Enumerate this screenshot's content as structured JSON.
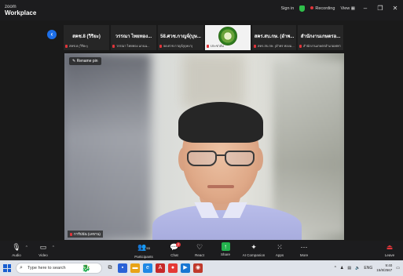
{
  "app": {
    "logo_top": "zoom",
    "logo_bottom": "Workplace"
  },
  "titlebar": {
    "signin": "Sign in",
    "recording": "Recording",
    "view": "View",
    "minimize": "–",
    "restore": "❐",
    "close": "✕"
  },
  "gallery": {
    "back": "‹",
    "tiles": [
      {
        "name": "สคช.8 (วิริยะ)",
        "sub": "สคช.8 (วิริยะ)"
      },
      {
        "name": "วรรณา ไทยทอง...",
        "sub": "วรรณา ไทยทอง แกนน..."
      },
      {
        "name": "58.ศวช.กาญจ์(บุษ...",
        "sub": "58.ศวช.กาญจ์(บุษบา)"
      },
      {
        "name": "",
        "sub": "ประชาสัม"
      },
      {
        "name": "สคร.สบ.กษ. (อำพ...",
        "sub": "สคร.สบ.กษ. (อำพร ทองม..."
      },
      {
        "name": "สำนักงานเกษตรอ...",
        "sub": "สำนักงานเกษตรอำเภอเทพา"
      }
    ]
  },
  "speaker": {
    "rename": "Rename pin",
    "name": "การ์ปนัน (เลขาน)"
  },
  "toolbar": {
    "audio": "Audio",
    "video": "Video",
    "participants": "Participants",
    "participants_count": "53",
    "chat": "Chat",
    "chat_badge": "2",
    "react": "React",
    "share": "Share",
    "ai": "AI Companion",
    "apps": "Apps",
    "more": "More",
    "leave": "Leave"
  },
  "taskbar": {
    "search_placeholder": "Type here to search",
    "lang": "ENG",
    "time": "9:40",
    "date": "15/8/2567"
  },
  "colors": {
    "accent": "#1d6fe8",
    "share": "#23b14d",
    "danger": "#e0353a"
  }
}
